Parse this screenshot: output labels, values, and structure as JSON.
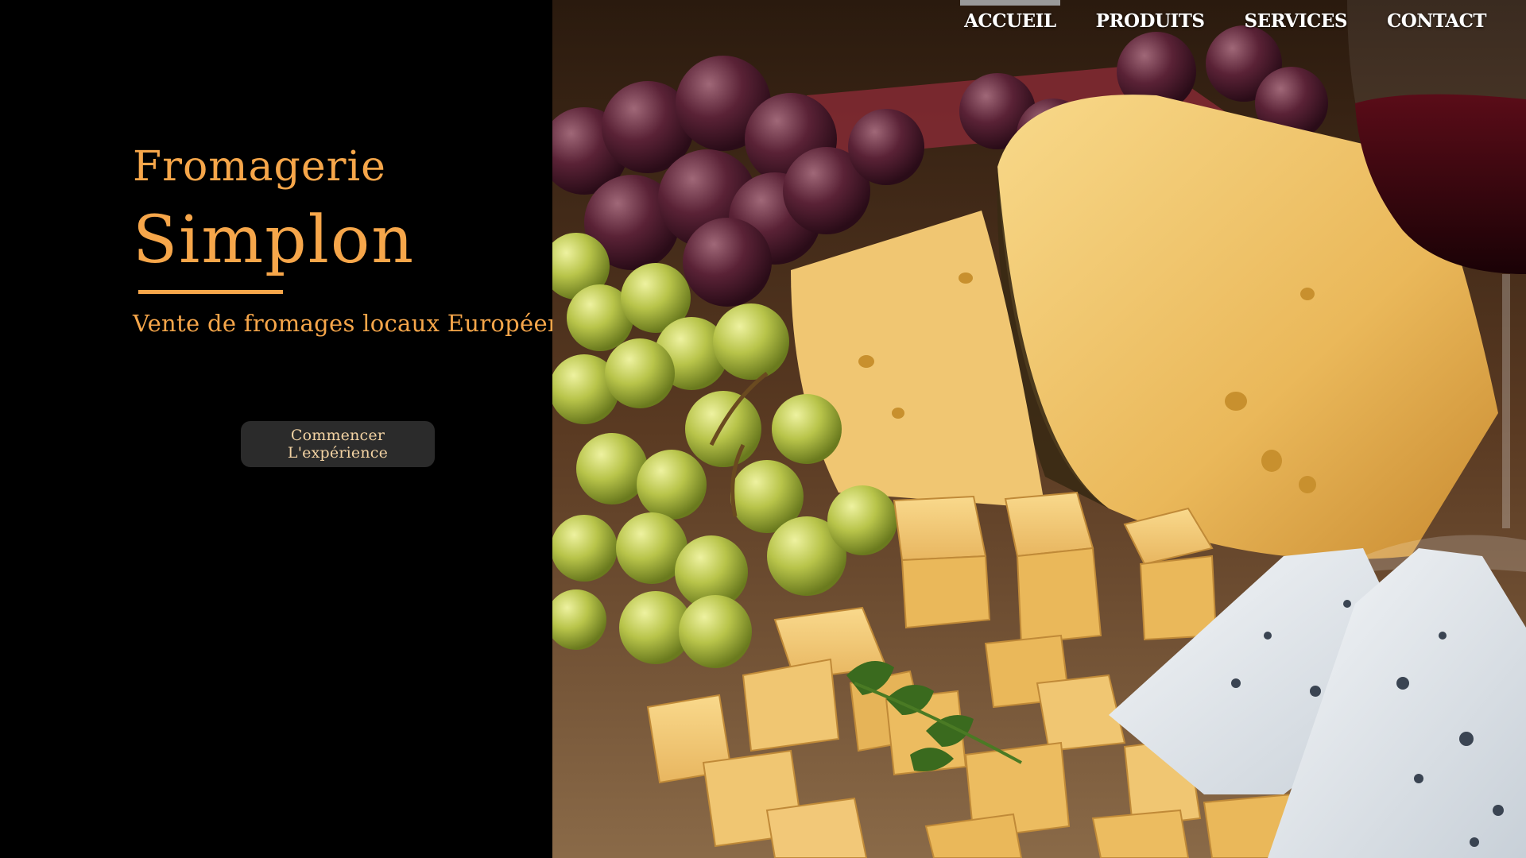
{
  "theme": {
    "accent": "#f6a64a"
  },
  "brand": {
    "line1": "Fromagerie",
    "line2": "Simplon",
    "tagline": "Vente de fromages locaux Européens"
  },
  "cta": {
    "label": "Commencer L'expérience"
  },
  "nav": {
    "items": [
      {
        "label": "ACCUEIL",
        "active": true
      },
      {
        "label": "PRODUITS",
        "active": false
      },
      {
        "label": "SERVICES",
        "active": false
      },
      {
        "label": "CONTACT",
        "active": false
      }
    ]
  },
  "hero_image": {
    "subject": "cheese-platter-with-grapes-and-wine"
  }
}
